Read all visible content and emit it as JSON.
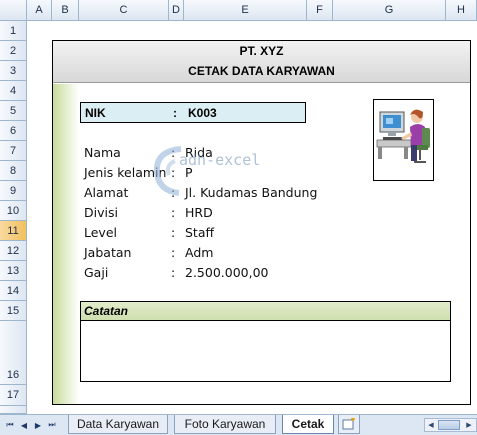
{
  "spreadsheet": {
    "columns": [
      "A",
      "B",
      "C",
      "D",
      "E",
      "F",
      "G",
      "H"
    ],
    "rows": [
      "1",
      "2",
      "3",
      "4",
      "5",
      "6",
      "7",
      "8",
      "9",
      "10",
      "11",
      "12",
      "13",
      "14",
      "15",
      "16",
      "17"
    ],
    "active_row": "11"
  },
  "form": {
    "company": "PT. XYZ",
    "title": "CETAK DATA KARYAWAN",
    "nik_label": "NIK",
    "nik_colon": ":",
    "nik_value": "K003",
    "fields": [
      {
        "label": "Nama",
        "colon": ":",
        "value": "Rida"
      },
      {
        "label": "Jenis kelamin",
        "colon": ":",
        "value": "P"
      },
      {
        "label": "Alamat",
        "colon": ":",
        "value": "Jl. Kudamas Bandung"
      },
      {
        "label": "Divisi",
        "colon": ":",
        "value": "HRD"
      },
      {
        "label": "Level",
        "colon": ":",
        "value": "Staff"
      },
      {
        "label": "Jabatan",
        "colon": ":",
        "value": "Adm"
      },
      {
        "label": "Gaji",
        "colon": ":",
        "value": "2.500.000,00"
      }
    ],
    "catatan_label": "Catatan",
    "photo_icon": "person-at-computer-icon"
  },
  "watermark": {
    "text": "adh-excel"
  },
  "sheet_tabs": [
    {
      "label": "Data Karyawan",
      "active": false
    },
    {
      "label": "Foto Karyawan",
      "active": false
    },
    {
      "label": "Cetak",
      "active": true
    }
  ],
  "colors": {
    "header_bg": "#dde6f1",
    "active_row_header": "#f1c15f",
    "nik_bg": "#dbeef4",
    "catatan_bg": "#d0dfae",
    "title_band_bg": "#d8d8d8"
  }
}
